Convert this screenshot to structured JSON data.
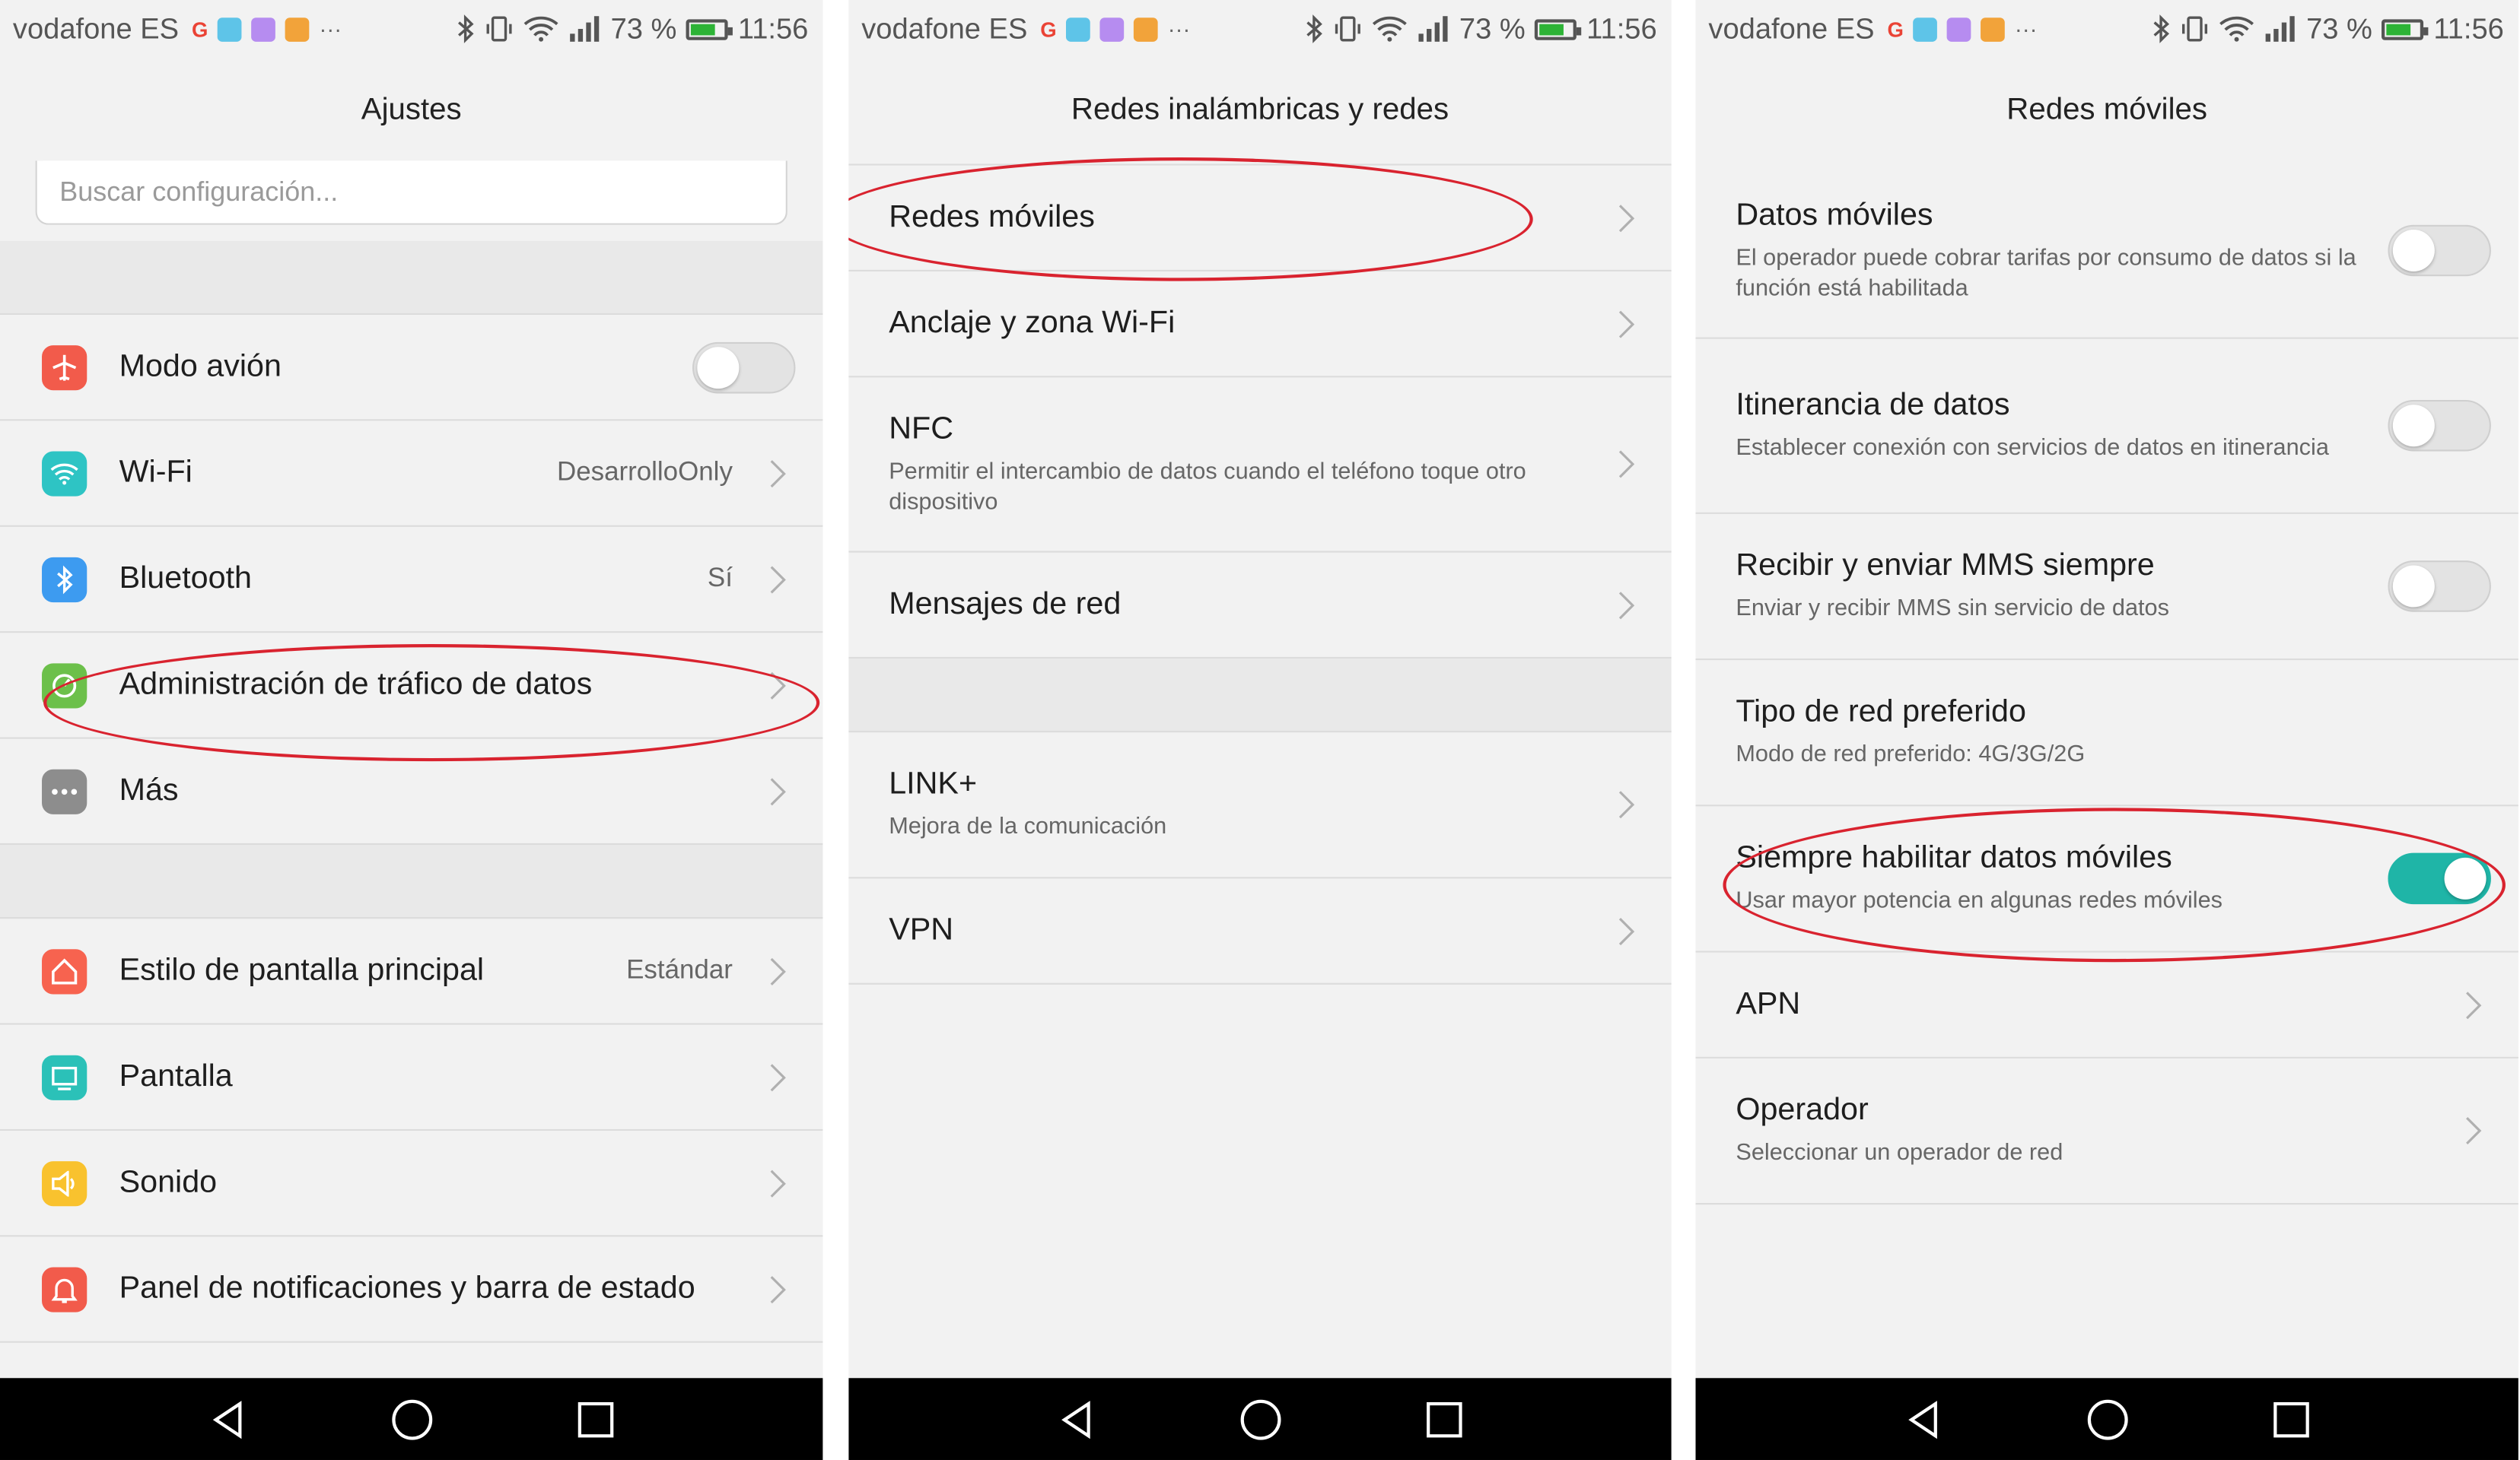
{
  "colors": {
    "toggle_on": "#1fb5a7",
    "annotation": "#d9232f",
    "nav_bar": "#000000",
    "screen_bg": "#f2f2f2"
  },
  "status_bar": {
    "carrier": "vodafone ES",
    "battery": "73 %",
    "time": "11:56",
    "notification_icons": [
      "google-icon",
      "android-icon",
      "gallery-icon",
      "app-icon"
    ],
    "more": "···"
  },
  "screen1": {
    "title": "Ajustes",
    "search_placeholder": "Buscar configuración...",
    "items": [
      {
        "label": "Modo avión",
        "icon": "airplane-icon",
        "color": "#f25b4b",
        "toggle": false
      },
      {
        "label": "Wi-Fi",
        "icon": "wifi-icon",
        "color": "#2ec4c4",
        "value": "DesarrolloOnly"
      },
      {
        "label": "Bluetooth",
        "icon": "bluetooth-icon",
        "color": "#3d9bf0",
        "value": "Sí"
      },
      {
        "label": "Administración de tráfico de datos",
        "icon": "data-traffic-icon",
        "color": "#6cc04a"
      },
      {
        "label": "Más",
        "icon": "more-icon",
        "color": "#8d8d8d"
      },
      {
        "label": "Estilo de pantalla principal",
        "icon": "home-style-icon",
        "color": "#f7634f",
        "value": "Estándar"
      },
      {
        "label": "Pantalla",
        "icon": "display-icon",
        "color": "#2bc1b8"
      },
      {
        "label": "Sonido",
        "icon": "sound-icon",
        "color": "#f9c22e"
      },
      {
        "label": "Panel de notificaciones y barra de estado",
        "icon": "notification-icon",
        "color": "#f25b4b"
      }
    ]
  },
  "screen2": {
    "title": "Redes inalámbricas y redes",
    "items": [
      {
        "label": "Redes móviles"
      },
      {
        "label": "Anclaje y zona Wi-Fi"
      },
      {
        "label": "NFC",
        "sub": "Permitir el intercambio de datos cuando el teléfono toque otro dispositivo"
      },
      {
        "label": "Mensajes de red"
      },
      {
        "label": "LINK+",
        "sub": "Mejora de la comunicación"
      },
      {
        "label": "VPN"
      }
    ]
  },
  "screen3": {
    "title": "Redes móviles",
    "items": [
      {
        "label": "Datos móviles",
        "sub": "El operador puede cobrar tarifas por consumo de datos si la función está habilitada",
        "toggle": false
      },
      {
        "label": "Itinerancia de datos",
        "sub": "Establecer conexión con servicios de datos en itinerancia",
        "toggle": false
      },
      {
        "label": "Recibir y enviar MMS siempre",
        "sub": "Enviar y recibir MMS sin servicio de datos",
        "toggle": false
      },
      {
        "label": "Tipo de red preferido",
        "sub": "Modo de red preferido: 4G/3G/2G"
      },
      {
        "label": "Siempre habilitar datos móviles",
        "sub": "Usar mayor potencia en algunas redes móviles",
        "toggle": true
      },
      {
        "label": "APN"
      },
      {
        "label": "Operador",
        "sub": "Seleccionar un operador de red"
      }
    ]
  }
}
